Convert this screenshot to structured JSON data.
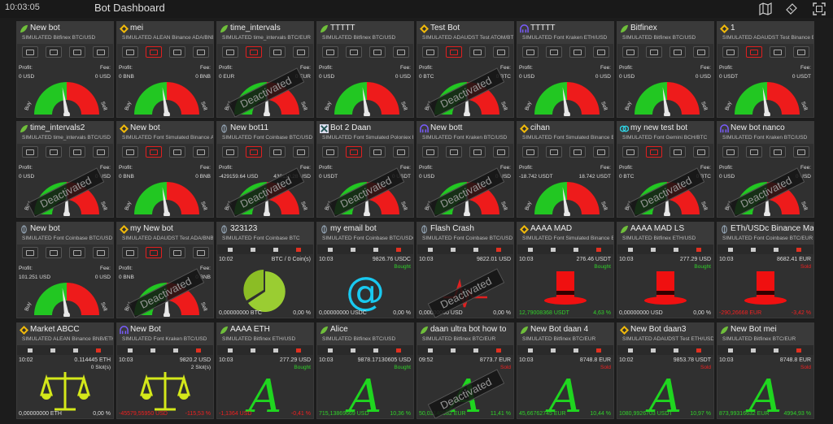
{
  "header": {
    "time": "10:03:05",
    "title": "Bot Dashboard",
    "icons": [
      "map-icon",
      "ticket-icon",
      "fullscreen-icon"
    ]
  },
  "rows": [
    [
      {
        "ex": "bitfinex",
        "name": "New bot",
        "sub": "SIMULATED Bitfinex BTC/USD",
        "profit": "0 USD",
        "fee": "0 USD",
        "mode": "gauge",
        "deact": false,
        "redbtn": false,
        "needle": 0.45
      },
      {
        "ex": "binance",
        "name": "mei",
        "sub": "SIMULATED ALEAN Binance ADA/BNB",
        "profit": "0 BNB",
        "fee": "0 BNB",
        "mode": "gauge",
        "deact": false,
        "redbtn": true,
        "needle": 0.45
      },
      {
        "ex": "bitfinex",
        "name": "time_intervals",
        "sub": "SIMULATED time_intervals BTC/EUR",
        "profit": "0 EUR",
        "fee": "0 EUR",
        "mode": "gauge",
        "deact": true,
        "redbtn": true,
        "needle": 0.5
      },
      {
        "ex": "bitfinex",
        "name": "TTTTT",
        "sub": "SIMULATED Bitfinex BTC/USD",
        "profit": "0 USD",
        "fee": "0 USD",
        "mode": "gauge",
        "deact": false,
        "redbtn": false,
        "needle": 0.45
      },
      {
        "ex": "binance",
        "name": "Test Bot",
        "sub": "SIMULATED ADAUDST Test ATOM/BTC",
        "profit": "0 BTC",
        "fee": "0 BTC",
        "mode": "gauge",
        "deact": true,
        "redbtn": true,
        "needle": 0.5
      },
      {
        "ex": "kraken",
        "name": "TTTTT",
        "sub": "SIMULATED Font Kraken ETH/USD",
        "profit": "0 USD",
        "fee": "0 USD",
        "mode": "gauge",
        "deact": false,
        "redbtn": false,
        "needle": 0.45
      },
      {
        "ex": "bitfinex",
        "name": "Bitfinex",
        "sub": "SIMULATED Bitfinex BTC/USD",
        "profit": "0 USD",
        "fee": "0 USD",
        "mode": "gauge",
        "deact": false,
        "redbtn": false,
        "needle": 0.45
      },
      {
        "ex": "binance",
        "name": "1",
        "sub": "SIMULATED ADAUDST Test Binance EDGT/USDT",
        "profit": "0 USDT",
        "fee": "0 USDT",
        "mode": "gauge",
        "deact": false,
        "redbtn": true,
        "needle": 0.45
      }
    ],
    [
      {
        "ex": "bitfinex",
        "name": "time_intervals2",
        "sub": "SIMULATED time_intervals BTC/USD",
        "profit": "0 USD",
        "fee": "0 USD",
        "mode": "gauge",
        "deact": true,
        "redbtn": false,
        "needle": 0.5
      },
      {
        "ex": "binance",
        "name": "New bot",
        "sub": "SIMULATED Font Simulated Binance ADA/BNB",
        "profit": "0 BNB",
        "fee": "0 BNB",
        "mode": "gauge",
        "deact": false,
        "redbtn": true,
        "needle": 0.45
      },
      {
        "ex": "coinbase",
        "name": "New bot11",
        "sub": "SIMULATED Font Coinbase BTC/USD",
        "profit": "-429159.64 USD",
        "fee": "430110.28 USD",
        "mode": "gauge",
        "deact": true,
        "redbtn": true,
        "needle": 0.5
      },
      {
        "ex": "poloniex",
        "name": "Bot 2 Daan",
        "sub": "SIMULATED Font Simulated Poloniex BTC/USDT",
        "profit": "0 USDT",
        "fee": "0 USDT",
        "mode": "gauge",
        "deact": true,
        "redbtn": true,
        "needle": 0.5
      },
      {
        "ex": "kraken",
        "name": "New bott",
        "sub": "SIMULATED Font Kraken BTC/USD",
        "profit": "0 USD",
        "fee": "0 USD",
        "mode": "gauge",
        "deact": true,
        "redbtn": false,
        "needle": 0.5
      },
      {
        "ex": "binance",
        "name": "cihan",
        "sub": "SIMULATED Font Simulated Binance BTC/USDT",
        "profit": "-18.742 USDT",
        "fee": "18.742 USDT",
        "mode": "gauge",
        "deact": false,
        "redbtn": false,
        "needle": 0.45
      },
      {
        "ex": "gemini",
        "name": "my new test bot",
        "sub": "SIMULATED Font Gemini BCH/BTC",
        "profit": "0 BTC",
        "fee": "0 BTC",
        "mode": "gauge",
        "deact": true,
        "redbtn": true,
        "needle": 0.5
      },
      {
        "ex": "kraken",
        "name": "New bot nanco",
        "sub": "SIMULATED Font Kraken BTC/USD",
        "profit": "0 USD",
        "fee": "0 USD",
        "mode": "gauge",
        "deact": true,
        "redbtn": false,
        "needle": 0.5
      }
    ],
    [
      {
        "ex": "coinbase",
        "name": "New bot",
        "sub": "SIMULATED Font Coinbase BTC/USD",
        "profit": "101.251 USD",
        "fee": "0 USD",
        "mode": "gauge",
        "deact": false,
        "redbtn": false,
        "needle": 0.45
      },
      {
        "ex": "binance",
        "name": "my New bot",
        "sub": "SIMULATED ADAUDST Test ADA/BNB",
        "profit": "0 BNB",
        "fee": "0 BNB",
        "mode": "gauge",
        "deact": true,
        "redbtn": true,
        "needle": 0.5
      },
      {
        "ex": "coinbase",
        "name": "323123",
        "sub": "SIMULATED Font Coinbase BTC",
        "mode": "pie",
        "time": "10:02",
        "amount": "BTC / 0 Coin(s)",
        "status": "",
        "bottom": "0,00000000 BTC",
        "pct": "0,00 %",
        "bottomColor": "#ddd",
        "pctColor": "#ddd"
      },
      {
        "ex": "coinbase",
        "name": "my email bot",
        "sub": "SIMULATED Font Coinbase BTC/USDC",
        "mode": "at",
        "time": "10:03",
        "amount": "9826.76 USDC",
        "status": "Bought",
        "bottom": "0,00000000 USDC",
        "pct": "0,00 %",
        "bottomColor": "#ddd",
        "pctColor": "#ddd"
      },
      {
        "ex": "coinbase",
        "name": "Flash Crash",
        "sub": "SIMULATED Font Coinbase BTC/USD",
        "mode": "crash",
        "time": "10:03",
        "amount": "9822.01 USD",
        "status": "",
        "bottom": "0,00000000 USD",
        "pct": "0,00 %",
        "bottomColor": "#ddd",
        "pctColor": "#ddd",
        "deact": true
      },
      {
        "ex": "binance",
        "name": "AAAA MAD",
        "sub": "SIMULATED Font Simulated Binance ETH/USDT",
        "mode": "hat",
        "time": "10:03",
        "amount": "276.46 USDT",
        "status": "Bought",
        "bottom": "12,79008368 USDT",
        "pct": "4,63 %",
        "bottomColor": "#31d12a",
        "pctColor": "#31d12a"
      },
      {
        "ex": "bitfinex",
        "name": "AAAA MAD LS",
        "sub": "SIMULATED Bitfinex ETH/USD",
        "mode": "hat",
        "time": "10:03",
        "amount": "277.29 USD",
        "status": "Bought",
        "bottom": "0,00000000 USD",
        "pct": "0,00 %",
        "bottomColor": "#ddd",
        "pctColor": "#ddd"
      },
      {
        "ex": "coinbase",
        "name": "ETh/USDc Binance Mad Hatter",
        "sub": "SIMULATED Font Coinbase BTC/EUR",
        "mode": "hat",
        "time": "10:03",
        "amount": "8682.41 EUR",
        "status": "Sold",
        "bottom": "-290,26668 EUR",
        "pct": "-3,42 %",
        "bottomColor": "#f02020",
        "pctColor": "#f02020"
      }
    ],
    [
      {
        "ex": "binance",
        "name": "Market ABCC",
        "sub": "SIMULATED ALEAN Binance BNB/ETH",
        "mode": "scale",
        "time": "10:02",
        "amount": "0.114445 ETH",
        "status": "0 Slot(s)",
        "statusColor": "#ddd",
        "bottom": "0,00000000 ETH",
        "pct": "0,00 %",
        "bottomColor": "#ddd",
        "pctColor": "#ddd"
      },
      {
        "ex": "kraken",
        "name": "New Bot",
        "sub": "SIMULATED Font Kraken BTC/USD",
        "mode": "scale",
        "time": "10:03",
        "amount": "9820.2 USD",
        "status": "2 Slot(s)",
        "statusColor": "#ddd",
        "bottom": "-45579,55950 USD",
        "pct": "-115,53 %",
        "bottomColor": "#f02020",
        "pctColor": "#f02020"
      },
      {
        "ex": "bitfinex",
        "name": "AAAA ETH",
        "sub": "SIMULATED Bitfinex ETH/USD",
        "mode": "alpha",
        "time": "10:03",
        "amount": "277.29 USD",
        "status": "Bought",
        "bottom": "-1,1364 USD",
        "pct": "-0,41 %",
        "bottomColor": "#f02020",
        "pctColor": "#f02020"
      },
      {
        "ex": "bitfinex",
        "name": "Alice",
        "sub": "SIMULATED Bitfinex BTC/USD",
        "mode": "alpha",
        "time": "10:03",
        "amount": "9878.17130605 USD",
        "status": "Bought",
        "bottom": "715,13869669 USD",
        "pct": "10,36 %",
        "bottomColor": "#31d12a",
        "pctColor": "#31d12a"
      },
      {
        "ex": "bitfinex",
        "name": "daan ultra bot how to",
        "sub": "SIMULATED Bitfinex BTC/EUR",
        "mode": "alpha",
        "time": "09:52",
        "amount": "8773.7 EUR",
        "status": "Sold",
        "bottom": "50,03140982 EUR",
        "pct": "11,41 %",
        "bottomColor": "#31d12a",
        "pctColor": "#31d12a",
        "deact": true
      },
      {
        "ex": "bitfinex",
        "name": "New Bot daan 4",
        "sub": "SIMULATED Bitfinex BTC/EUR",
        "mode": "alpha",
        "time": "10:03",
        "amount": "8748.8 EUR",
        "status": "Sold",
        "bottom": "45,66762745 EUR",
        "pct": "10,44 %",
        "bottomColor": "#31d12a",
        "pctColor": "#31d12a"
      },
      {
        "ex": "binance",
        "name": "New Bot daan3",
        "sub": "SIMULATED ADAUDST Test ETH/USDT",
        "mode": "alpha",
        "time": "10:02",
        "amount": "9853.78 USDT",
        "status": "Sold",
        "bottom": "1080,9926703 USDT",
        "pct": "10,97 %",
        "bottomColor": "#31d12a",
        "pctColor": "#31d12a"
      },
      {
        "ex": "bitfinex",
        "name": "New Bot mei",
        "sub": "SIMULATED Bitfinex BTC/EUR",
        "mode": "alpha",
        "time": "10:03",
        "amount": "8748.8 EUR",
        "status": "Sold",
        "bottom": "873,99316632 EUR",
        "pct": "4994,93 %",
        "bottomColor": "#31d12a",
        "pctColor": "#31d12a"
      }
    ]
  ],
  "labels": {
    "profit": "Profit:",
    "fee": "Fee:",
    "buy": "Buy",
    "sell": "Sell",
    "deactivated": "Deactivated"
  },
  "colors": {
    "green": "#31d12a",
    "red": "#f02020",
    "gaugeGreen": "#22c722",
    "gaugeRed": "#ee1b1b",
    "cyan": "#19c9f0",
    "lime": "#d4e81a"
  }
}
